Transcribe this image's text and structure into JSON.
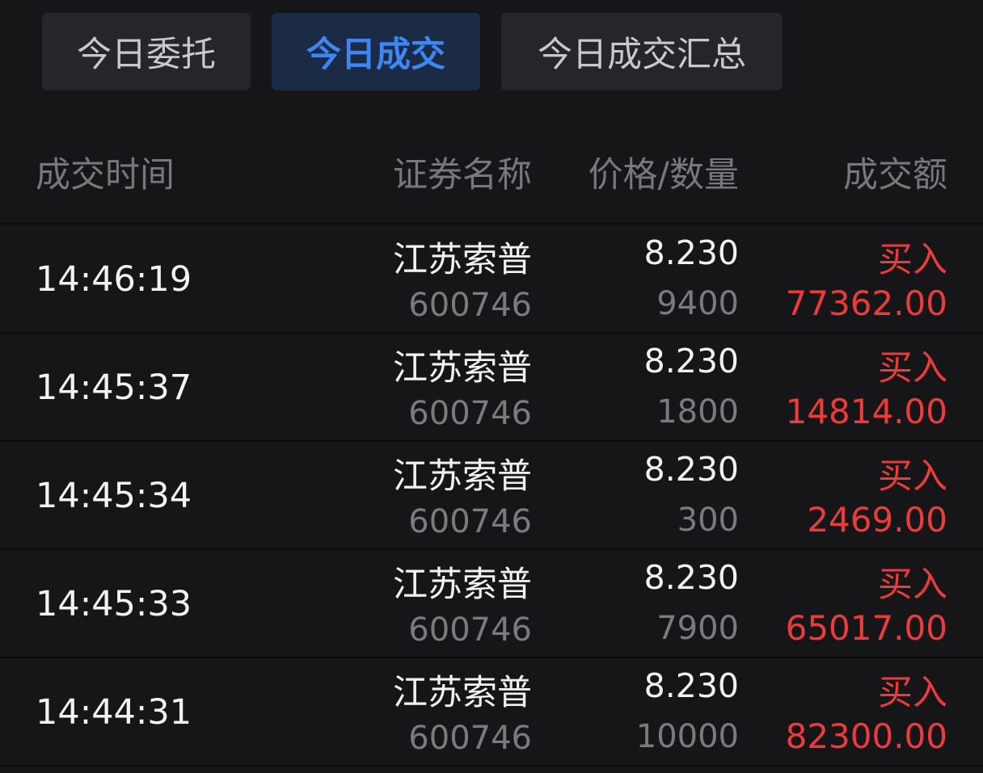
{
  "tabs": [
    {
      "label": "今日委托",
      "active": false
    },
    {
      "label": "今日成交",
      "active": true
    },
    {
      "label": "今日成交汇总",
      "active": false
    }
  ],
  "columns": {
    "time": "成交时间",
    "name": "证券名称",
    "price_qty": "价格/数量",
    "amount": "成交额"
  },
  "rows": [
    {
      "time": "14:46:19",
      "name": "江苏索普",
      "code": "600746",
      "price": "8.230",
      "quantity": "9400",
      "side": "买入",
      "amount": "77362.00"
    },
    {
      "time": "14:45:37",
      "name": "江苏索普",
      "code": "600746",
      "price": "8.230",
      "quantity": "1800",
      "side": "买入",
      "amount": "14814.00"
    },
    {
      "time": "14:45:34",
      "name": "江苏索普",
      "code": "600746",
      "price": "8.230",
      "quantity": "300",
      "side": "买入",
      "amount": "2469.00"
    },
    {
      "time": "14:45:33",
      "name": "江苏索普",
      "code": "600746",
      "price": "8.230",
      "quantity": "7900",
      "side": "买入",
      "amount": "65017.00"
    },
    {
      "time": "14:44:31",
      "name": "江苏索普",
      "code": "600746",
      "price": "8.230",
      "quantity": "10000",
      "side": "买入",
      "amount": "82300.00"
    }
  ],
  "colors": {
    "background": "#161618",
    "tab_background": "#252629",
    "active_tab_background": "#1b2a45",
    "active_tab_text": "#3d86f4",
    "buy_red": "#ec3b3b",
    "muted_text": "#7a7b7f"
  }
}
